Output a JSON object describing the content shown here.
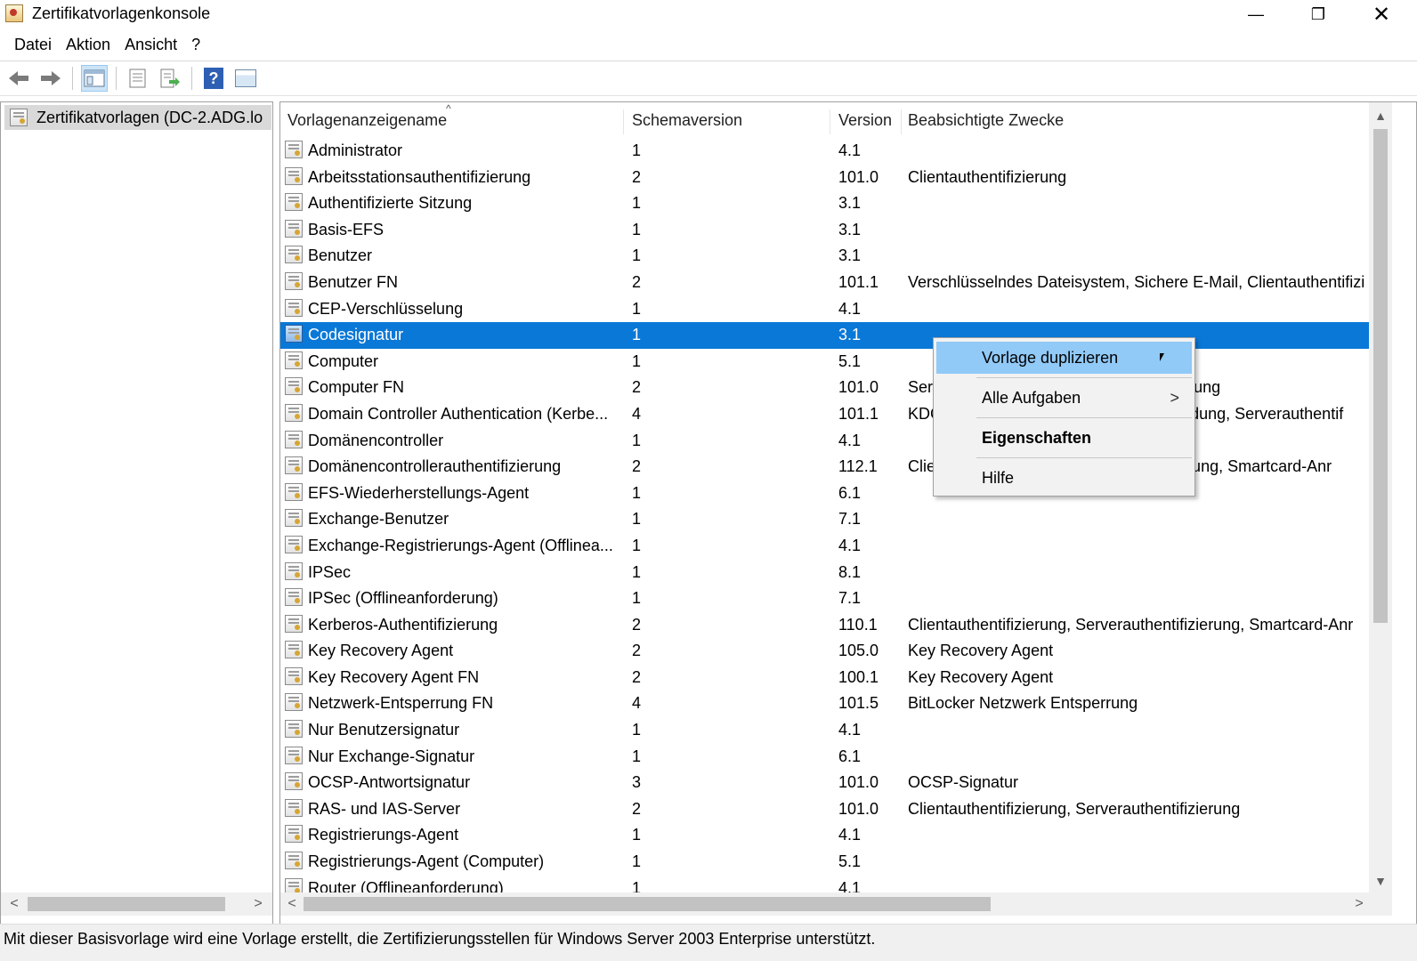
{
  "window": {
    "title": "Zertifikatvorlagenkonsole",
    "minimize_glyph": "—",
    "maximize_glyph": "❐",
    "close_glyph": "✕"
  },
  "menu": {
    "items": [
      "Datei",
      "Aktion",
      "Ansicht",
      "?"
    ]
  },
  "toolbar": {
    "back_icon": "back-arrow-icon",
    "forward_icon": "forward-arrow-icon",
    "help_label": "?"
  },
  "tree": {
    "root_label": "Zertifikatvorlagen (DC-2.ADG.lo"
  },
  "list": {
    "columns": [
      "Vorlagenanzeigename",
      "Schemaversion",
      "Version",
      "Beabsichtigte Zwecke"
    ],
    "sort_indicator": "^",
    "rows": [
      {
        "name": "Administrator",
        "schema": "1",
        "version": "4.1",
        "purpose": ""
      },
      {
        "name": "Arbeitsstationsauthentifizierung",
        "schema": "2",
        "version": "101.0",
        "purpose": "Clientauthentifizierung"
      },
      {
        "name": "Authentifizierte Sitzung",
        "schema": "1",
        "version": "3.1",
        "purpose": ""
      },
      {
        "name": "Basis-EFS",
        "schema": "1",
        "version": "3.1",
        "purpose": ""
      },
      {
        "name": "Benutzer",
        "schema": "1",
        "version": "3.1",
        "purpose": ""
      },
      {
        "name": "Benutzer FN",
        "schema": "2",
        "version": "101.1",
        "purpose": "Verschlüsselndes Dateisystem, Sichere E-Mail, Clientauthentifizi"
      },
      {
        "name": "CEP-Verschlüsselung",
        "schema": "1",
        "version": "4.1",
        "purpose": ""
      },
      {
        "name": "Codesignatur",
        "schema": "1",
        "version": "3.1",
        "purpose": ""
      },
      {
        "name": "Computer",
        "schema": "1",
        "version": "5.1",
        "purpose": ""
      },
      {
        "name": "Computer FN",
        "schema": "2",
        "version": "101.0",
        "purpose": "Ser                                                    izierung"
      },
      {
        "name": "Domain Controller Authentication (Kerbe...",
        "schema": "4",
        "version": "101.1",
        "purpose": "KDC                                                   neldung, Serverauthentif"
      },
      {
        "name": "Domänencontroller",
        "schema": "1",
        "version": "4.1",
        "purpose": ""
      },
      {
        "name": "Domänencontrollerauthentifizierung",
        "schema": "2",
        "version": "112.1",
        "purpose": "Clie                                                   izierung, Smartcard-Anr"
      },
      {
        "name": "EFS-Wiederherstellungs-Agent",
        "schema": "1",
        "version": "6.1",
        "purpose": ""
      },
      {
        "name": "Exchange-Benutzer",
        "schema": "1",
        "version": "7.1",
        "purpose": ""
      },
      {
        "name": "Exchange-Registrierungs-Agent (Offlinea...",
        "schema": "1",
        "version": "4.1",
        "purpose": ""
      },
      {
        "name": "IPSec",
        "schema": "1",
        "version": "8.1",
        "purpose": ""
      },
      {
        "name": "IPSec (Offlineanforderung)",
        "schema": "1",
        "version": "7.1",
        "purpose": ""
      },
      {
        "name": "Kerberos-Authentifizierung",
        "schema": "2",
        "version": "110.1",
        "purpose": "Clientauthentifizierung, Serverauthentifizierung, Smartcard-Anr"
      },
      {
        "name": "Key Recovery Agent",
        "schema": "2",
        "version": "105.0",
        "purpose": "Key Recovery Agent"
      },
      {
        "name": "Key Recovery Agent FN",
        "schema": "2",
        "version": "100.1",
        "purpose": "Key Recovery Agent"
      },
      {
        "name": "Netzwerk-Entsperrung FN",
        "schema": "4",
        "version": "101.5",
        "purpose": "BitLocker Netzwerk Entsperrung"
      },
      {
        "name": "Nur Benutzersignatur",
        "schema": "1",
        "version": "4.1",
        "purpose": ""
      },
      {
        "name": "Nur Exchange-Signatur",
        "schema": "1",
        "version": "6.1",
        "purpose": ""
      },
      {
        "name": "OCSP-Antwortsignatur",
        "schema": "3",
        "version": "101.0",
        "purpose": "OCSP-Signatur"
      },
      {
        "name": "RAS- und IAS-Server",
        "schema": "2",
        "version": "101.0",
        "purpose": "Clientauthentifizierung, Serverauthentifizierung"
      },
      {
        "name": "Registrierungs-Agent",
        "schema": "1",
        "version": "4.1",
        "purpose": ""
      },
      {
        "name": "Registrierungs-Agent (Computer)",
        "schema": "1",
        "version": "5.1",
        "purpose": ""
      },
      {
        "name": "Router (Offlineanforderung)",
        "schema": "1",
        "version": "4.1",
        "purpose": ""
      }
    ],
    "selected_index": 7
  },
  "context_menu": {
    "items": [
      {
        "label": "Vorlage duplizieren",
        "highlighted": true
      },
      {
        "label": "Alle Aufgaben",
        "submenu_arrow": ">"
      },
      {
        "label": "Eigenschaften",
        "bold": true
      },
      {
        "label": "Hilfe"
      }
    ]
  },
  "statusbar": {
    "text": "Mit dieser Basisvorlage wird eine Vorlage erstellt, die Zertifizierungsstellen für Windows Server 2003 Enterprise unterstützt."
  },
  "colors": {
    "selection": "#0a78d7",
    "menu_highlight": "#91c9f7",
    "tree_selection": "#d9d9d9"
  }
}
